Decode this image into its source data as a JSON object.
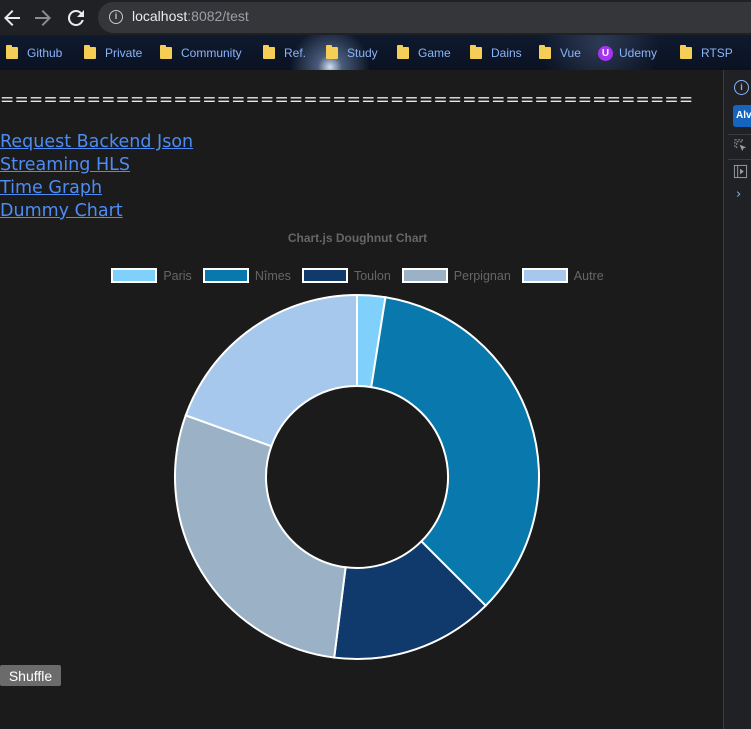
{
  "browser": {
    "url_host": "localhost",
    "url_rest": ":8082/test"
  },
  "bookmarks": [
    {
      "label": "Github",
      "icon": "folder-icon"
    },
    {
      "label": "Private",
      "icon": "folder-icon"
    },
    {
      "label": "Community",
      "icon": "folder-icon"
    },
    {
      "label": "Ref.",
      "icon": "folder-icon"
    },
    {
      "label": "Study",
      "icon": "folder-icon"
    },
    {
      "label": "Game",
      "icon": "folder-icon"
    },
    {
      "label": "Dains",
      "icon": "folder-icon"
    },
    {
      "label": "Vue",
      "icon": "folder-icon"
    },
    {
      "label": "Udemy",
      "icon": "udemy-icon"
    },
    {
      "label": "RTSP",
      "icon": "folder-icon"
    }
  ],
  "sidepanel": {
    "badge": "Alv"
  },
  "page": {
    "separator": "================================================",
    "links": {
      "request_backend_json": "Request Backend Json",
      "streaming_hls": "Streaming HLS",
      "time_graph": "Time Graph",
      "dummy_chart": "Dummy Chart"
    },
    "shuffle_label": "Shuffle"
  },
  "chart_data": {
    "type": "doughnut",
    "title": "Chart.js Doughnut Chart",
    "legend_position": "top",
    "categories": [
      "Paris",
      "Nîmes",
      "Toulon",
      "Perpignan",
      "Autre"
    ],
    "values": [
      2.5,
      35,
      14.5,
      28.5,
      19.5
    ],
    "unit": "%",
    "colors": [
      "#7fd0fa",
      "#0878ad",
      "#103a6b",
      "#9bb1c6",
      "#a6c8ec"
    ],
    "border_color": "#ffffff",
    "cutout_fraction": 0.5
  }
}
